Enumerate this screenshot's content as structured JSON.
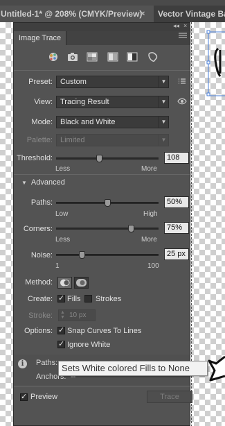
{
  "tabs": {
    "active_title": "Untitled-1* @ 208% (CMYK/Preview)",
    "close_glyph": "×",
    "other_title": "Vector Vintage Ban"
  },
  "panel": {
    "title": "Image Trace",
    "collapse_glyph": "◂◂",
    "close_glyph": "×",
    "menu_glyph": "≡",
    "preset_icons": [
      "auto-color-icon",
      "high-color-icon",
      "low-color-icon",
      "grayscale-icon",
      "black-and-white-icon",
      "outline-icon"
    ],
    "preset_label": "Preset:",
    "preset_value": "Custom",
    "view_label": "View:",
    "view_value": "Tracing Result",
    "mode_label": "Mode:",
    "mode_value": "Black and White",
    "palette_label": "Palette:",
    "palette_value": "Limited",
    "threshold_label": "Threshold:",
    "threshold_value": "108",
    "threshold_fraction": 0.42,
    "threshold_min": "Less",
    "threshold_max": "More",
    "advanced_label": "Advanced",
    "paths_label": "Paths:",
    "paths_value": "50%",
    "paths_fraction": 0.5,
    "paths_min": "Low",
    "paths_max": "High",
    "corners_label": "Corners:",
    "corners_value": "75%",
    "corners_fraction": 0.75,
    "corners_min": "Less",
    "corners_max": "More",
    "noise_label": "Noise:",
    "noise_value": "25 px",
    "noise_fraction": 0.24,
    "noise_min": "1",
    "noise_max": "100",
    "method_label": "Method:",
    "create_label": "Create:",
    "fills_label": "Fills",
    "fills_checked": true,
    "strokes_label": "Strokes",
    "strokes_checked": false,
    "stroke_label": "Stroke:",
    "stroke_value": "10 px",
    "options_label": "Options:",
    "snap_label": "Snap Curves To Lines",
    "snap_checked": true,
    "ignore_white_label": "Ignore White",
    "ignore_white_checked": true,
    "info_paths_label": "Paths:",
    "info_anchors_label": "Anchors:",
    "info_anchors_value": "--",
    "preview_label": "Preview",
    "preview_checked": true,
    "trace_label": "Trace"
  },
  "tooltip": {
    "text": "Sets White colored Fills to None"
  }
}
